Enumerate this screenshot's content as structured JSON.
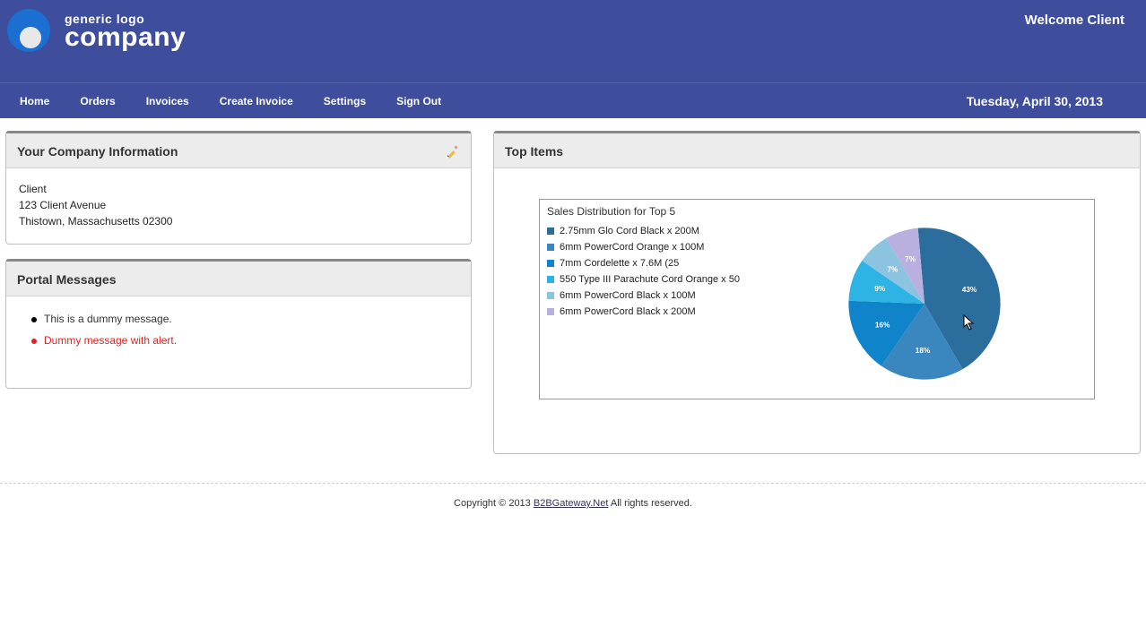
{
  "header": {
    "logo_line1": "generic logo",
    "logo_line2": "company",
    "welcome": "Welcome Client"
  },
  "nav": {
    "items": [
      "Home",
      "Orders",
      "Invoices",
      "Create Invoice",
      "Settings",
      "Sign Out"
    ],
    "date": "Tuesday, April 30, 2013"
  },
  "company_info": {
    "title": "Your Company Information",
    "lines": [
      "Client",
      "123 Client Avenue",
      "Thistown, Massachusetts  02300"
    ]
  },
  "portal_messages": {
    "title": "Portal Messages",
    "items": [
      {
        "text": "This is a dummy message.",
        "alert": false
      },
      {
        "text": "Dummy message with alert.",
        "alert": true
      }
    ]
  },
  "top_items": {
    "title": "Top Items"
  },
  "chart_data": {
    "type": "pie",
    "title": "Sales Distribution for Top 5",
    "series": [
      {
        "name": "2.75mm Glo Cord Black x 200M",
        "value": 43,
        "label": "43%",
        "color": "#2b6d9c"
      },
      {
        "name": "6mm PowerCord Orange x 100M",
        "value": 18,
        "label": "18%",
        "color": "#3a87c0"
      },
      {
        "name": "7mm Cordelette x 7.6M (25",
        "value": 16,
        "label": "16%",
        "color": "#0f84ca"
      },
      {
        "name": "550 Type III Parachute Cord Orange x 50",
        "value": 9,
        "label": "9%",
        "color": "#2db4e5"
      },
      {
        "name": "6mm PowerCord Black x 100M",
        "value": 7,
        "label": "7%",
        "color": "#8bc3e1"
      },
      {
        "name": "6mm PowerCord Black x 200M",
        "value": 7,
        "label": "7%",
        "color": "#b9b0e0"
      }
    ]
  },
  "footer": {
    "prefix": "Copyright © 2013 ",
    "link": "B2BGateway.Net",
    "suffix": " All rights reserved."
  }
}
